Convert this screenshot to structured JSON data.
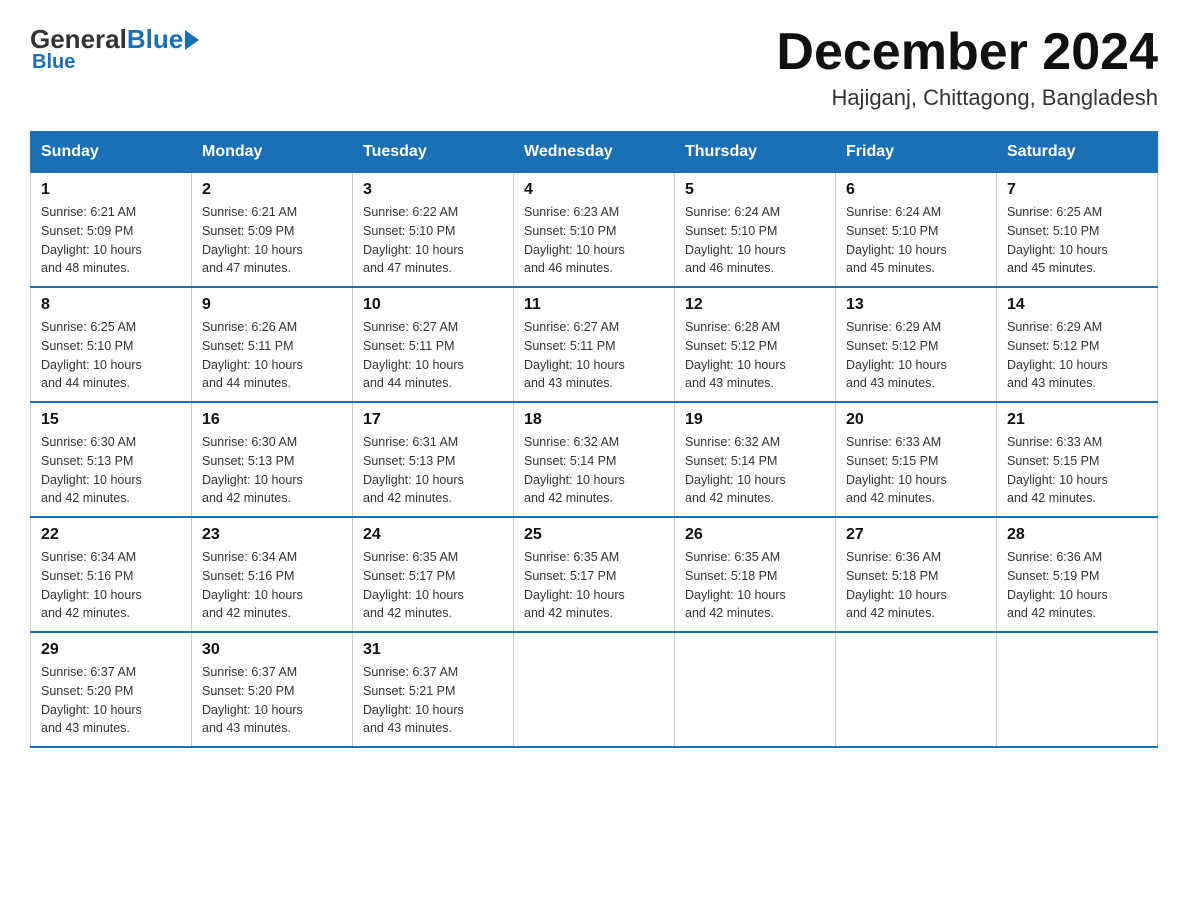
{
  "logo": {
    "general": "General",
    "blue": "Blue",
    "arrow": "▶"
  },
  "header": {
    "month": "December 2024",
    "location": "Hajiganj, Chittagong, Bangladesh"
  },
  "days": {
    "headers": [
      "Sunday",
      "Monday",
      "Tuesday",
      "Wednesday",
      "Thursday",
      "Friday",
      "Saturday"
    ]
  },
  "weeks": [
    [
      {
        "day": "1",
        "sunrise": "6:21 AM",
        "sunset": "5:09 PM",
        "daylight": "10 hours and 48 minutes."
      },
      {
        "day": "2",
        "sunrise": "6:21 AM",
        "sunset": "5:09 PM",
        "daylight": "10 hours and 47 minutes."
      },
      {
        "day": "3",
        "sunrise": "6:22 AM",
        "sunset": "5:10 PM",
        "daylight": "10 hours and 47 minutes."
      },
      {
        "day": "4",
        "sunrise": "6:23 AM",
        "sunset": "5:10 PM",
        "daylight": "10 hours and 46 minutes."
      },
      {
        "day": "5",
        "sunrise": "6:24 AM",
        "sunset": "5:10 PM",
        "daylight": "10 hours and 46 minutes."
      },
      {
        "day": "6",
        "sunrise": "6:24 AM",
        "sunset": "5:10 PM",
        "daylight": "10 hours and 45 minutes."
      },
      {
        "day": "7",
        "sunrise": "6:25 AM",
        "sunset": "5:10 PM",
        "daylight": "10 hours and 45 minutes."
      }
    ],
    [
      {
        "day": "8",
        "sunrise": "6:25 AM",
        "sunset": "5:10 PM",
        "daylight": "10 hours and 44 minutes."
      },
      {
        "day": "9",
        "sunrise": "6:26 AM",
        "sunset": "5:11 PM",
        "daylight": "10 hours and 44 minutes."
      },
      {
        "day": "10",
        "sunrise": "6:27 AM",
        "sunset": "5:11 PM",
        "daylight": "10 hours and 44 minutes."
      },
      {
        "day": "11",
        "sunrise": "6:27 AM",
        "sunset": "5:11 PM",
        "daylight": "10 hours and 43 minutes."
      },
      {
        "day": "12",
        "sunrise": "6:28 AM",
        "sunset": "5:12 PM",
        "daylight": "10 hours and 43 minutes."
      },
      {
        "day": "13",
        "sunrise": "6:29 AM",
        "sunset": "5:12 PM",
        "daylight": "10 hours and 43 minutes."
      },
      {
        "day": "14",
        "sunrise": "6:29 AM",
        "sunset": "5:12 PM",
        "daylight": "10 hours and 43 minutes."
      }
    ],
    [
      {
        "day": "15",
        "sunrise": "6:30 AM",
        "sunset": "5:13 PM",
        "daylight": "10 hours and 42 minutes."
      },
      {
        "day": "16",
        "sunrise": "6:30 AM",
        "sunset": "5:13 PM",
        "daylight": "10 hours and 42 minutes."
      },
      {
        "day": "17",
        "sunrise": "6:31 AM",
        "sunset": "5:13 PM",
        "daylight": "10 hours and 42 minutes."
      },
      {
        "day": "18",
        "sunrise": "6:32 AM",
        "sunset": "5:14 PM",
        "daylight": "10 hours and 42 minutes."
      },
      {
        "day": "19",
        "sunrise": "6:32 AM",
        "sunset": "5:14 PM",
        "daylight": "10 hours and 42 minutes."
      },
      {
        "day": "20",
        "sunrise": "6:33 AM",
        "sunset": "5:15 PM",
        "daylight": "10 hours and 42 minutes."
      },
      {
        "day": "21",
        "sunrise": "6:33 AM",
        "sunset": "5:15 PM",
        "daylight": "10 hours and 42 minutes."
      }
    ],
    [
      {
        "day": "22",
        "sunrise": "6:34 AM",
        "sunset": "5:16 PM",
        "daylight": "10 hours and 42 minutes."
      },
      {
        "day": "23",
        "sunrise": "6:34 AM",
        "sunset": "5:16 PM",
        "daylight": "10 hours and 42 minutes."
      },
      {
        "day": "24",
        "sunrise": "6:35 AM",
        "sunset": "5:17 PM",
        "daylight": "10 hours and 42 minutes."
      },
      {
        "day": "25",
        "sunrise": "6:35 AM",
        "sunset": "5:17 PM",
        "daylight": "10 hours and 42 minutes."
      },
      {
        "day": "26",
        "sunrise": "6:35 AM",
        "sunset": "5:18 PM",
        "daylight": "10 hours and 42 minutes."
      },
      {
        "day": "27",
        "sunrise": "6:36 AM",
        "sunset": "5:18 PM",
        "daylight": "10 hours and 42 minutes."
      },
      {
        "day": "28",
        "sunrise": "6:36 AM",
        "sunset": "5:19 PM",
        "daylight": "10 hours and 42 minutes."
      }
    ],
    [
      {
        "day": "29",
        "sunrise": "6:37 AM",
        "sunset": "5:20 PM",
        "daylight": "10 hours and 43 minutes."
      },
      {
        "day": "30",
        "sunrise": "6:37 AM",
        "sunset": "5:20 PM",
        "daylight": "10 hours and 43 minutes."
      },
      {
        "day": "31",
        "sunrise": "6:37 AM",
        "sunset": "5:21 PM",
        "daylight": "10 hours and 43 minutes."
      },
      null,
      null,
      null,
      null
    ]
  ],
  "labels": {
    "sunrise": "Sunrise:",
    "sunset": "Sunset:",
    "daylight": "Daylight:"
  }
}
